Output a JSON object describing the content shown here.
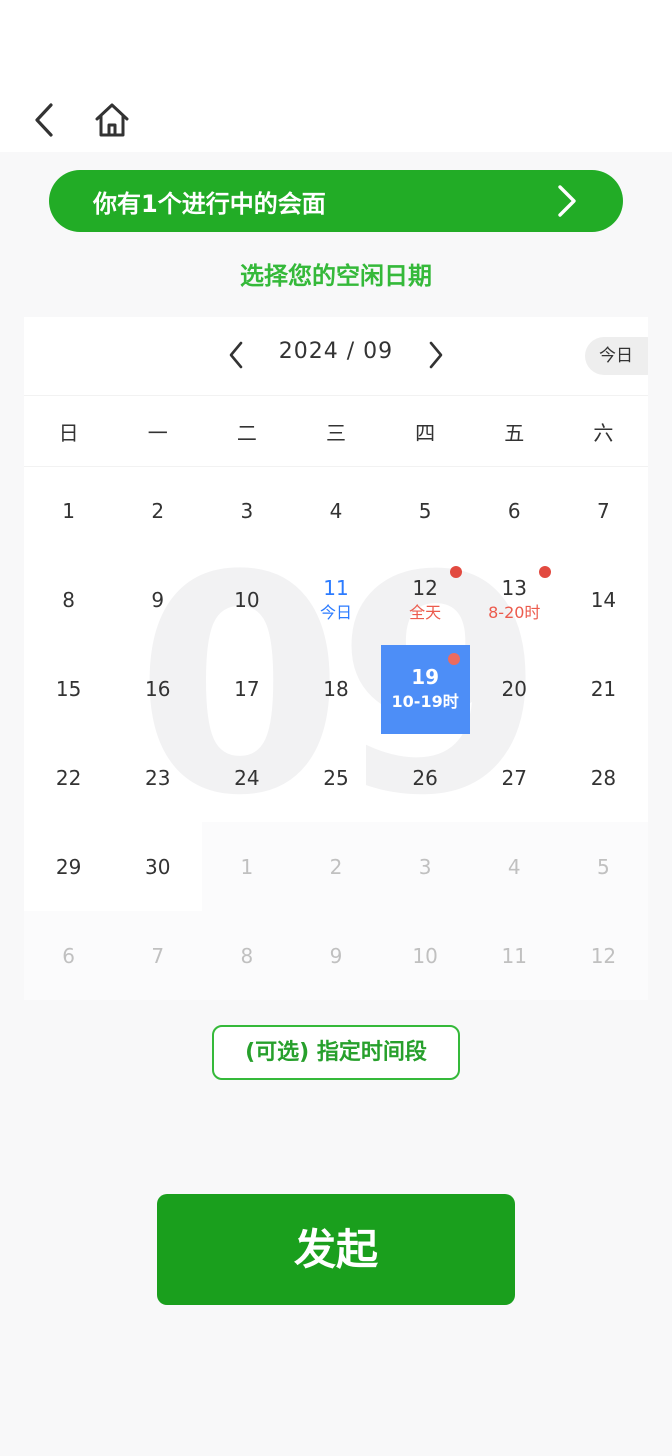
{
  "nav": {
    "back_icon": "chevron-left-icon",
    "home_icon": "home-icon"
  },
  "banner": {
    "text": "你有1个进行中的会面",
    "arrow_icon": "chevron-right-icon",
    "color": "#22ac26"
  },
  "subtitle": "选择您的空闲日期",
  "calendar": {
    "month_label": "2024 / 09",
    "today_label": "今日",
    "watermark": "09",
    "weekdays": [
      "日",
      "一",
      "二",
      "三",
      "四",
      "五",
      "六"
    ],
    "days": [
      {
        "num": "1"
      },
      {
        "num": "2"
      },
      {
        "num": "3"
      },
      {
        "num": "4"
      },
      {
        "num": "5"
      },
      {
        "num": "6"
      },
      {
        "num": "7"
      },
      {
        "num": "8"
      },
      {
        "num": "9"
      },
      {
        "num": "10"
      },
      {
        "num": "11",
        "sub": "今日",
        "state": "today"
      },
      {
        "num": "12",
        "sub": "全天",
        "state": "marked",
        "dot": true
      },
      {
        "num": "13",
        "sub": "8-20时",
        "state": "marked",
        "dot": true
      },
      {
        "num": "14"
      },
      {
        "num": "15"
      },
      {
        "num": "16"
      },
      {
        "num": "17"
      },
      {
        "num": "18"
      },
      {
        "num": "19",
        "sub": "10-19时",
        "state": "selected",
        "dot": true
      },
      {
        "num": "20"
      },
      {
        "num": "21"
      },
      {
        "num": "22"
      },
      {
        "num": "23"
      },
      {
        "num": "24"
      },
      {
        "num": "25"
      },
      {
        "num": "26"
      },
      {
        "num": "27"
      },
      {
        "num": "28"
      },
      {
        "num": "29"
      },
      {
        "num": "30"
      },
      {
        "num": "1",
        "state": "other"
      },
      {
        "num": "2",
        "state": "other"
      },
      {
        "num": "3",
        "state": "other"
      },
      {
        "num": "4",
        "state": "other"
      },
      {
        "num": "5",
        "state": "other"
      },
      {
        "num": "6",
        "state": "other"
      },
      {
        "num": "7",
        "state": "other"
      },
      {
        "num": "8",
        "state": "other"
      },
      {
        "num": "9",
        "state": "other"
      },
      {
        "num": "10",
        "state": "other"
      },
      {
        "num": "11",
        "state": "other"
      },
      {
        "num": "12",
        "state": "other"
      }
    ]
  },
  "time_button": "(可选) 指定时间段",
  "submit_button": "发起",
  "colors": {
    "primary": "#1a9f1d",
    "selected": "#4d8ef7",
    "today": "#2b7bff",
    "mark": "#e24a40"
  }
}
